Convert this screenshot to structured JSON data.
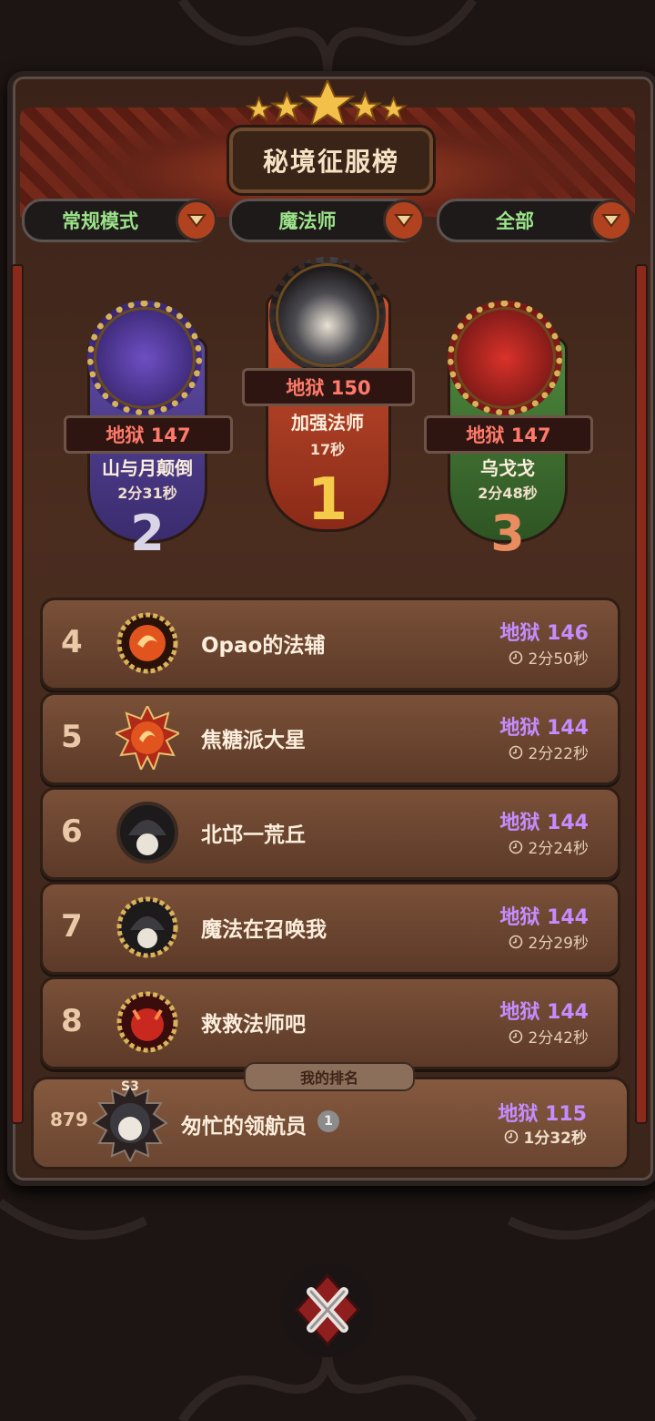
{
  "header": {
    "title": "秘境征服榜"
  },
  "filters": [
    {
      "label": "常规模式"
    },
    {
      "label": "魔法师"
    },
    {
      "label": "全部"
    }
  ],
  "podium": [
    {
      "rank": "1",
      "level": "地狱 150",
      "name": "加强法师",
      "time": "17秒",
      "color": "#b7402a"
    },
    {
      "rank": "2",
      "level": "地狱 147",
      "name": "山与月颠倒",
      "time": "2分31秒",
      "color": "#4b3a86"
    },
    {
      "rank": "3",
      "level": "地狱 147",
      "name": "乌戈戈",
      "time": "2分48秒",
      "color": "#3f6e34"
    }
  ],
  "rows": [
    {
      "rank": "4",
      "name": "Opao的法辅",
      "level": "地狱 146",
      "time": "2分50秒"
    },
    {
      "rank": "5",
      "name": "焦糖派大星",
      "level": "地狱 144",
      "time": "2分22秒"
    },
    {
      "rank": "6",
      "name": "北邙一荒丘",
      "level": "地狱 144",
      "time": "2分24秒"
    },
    {
      "rank": "7",
      "name": "魔法在召唤我",
      "level": "地狱 144",
      "time": "2分29秒"
    },
    {
      "rank": "8",
      "name": "救救法师吧",
      "level": "地狱 144",
      "time": "2分42秒"
    }
  ],
  "my_rank": {
    "tag": "我的排名",
    "rank": "879",
    "season": "S3",
    "name": "匆忙的领航员",
    "badge": "1",
    "level": "地狱 115",
    "time": "1分32秒"
  },
  "icons": {
    "close": "close-x-icon",
    "dropdown": "chevron-down-icon",
    "clock": "clock-icon"
  }
}
